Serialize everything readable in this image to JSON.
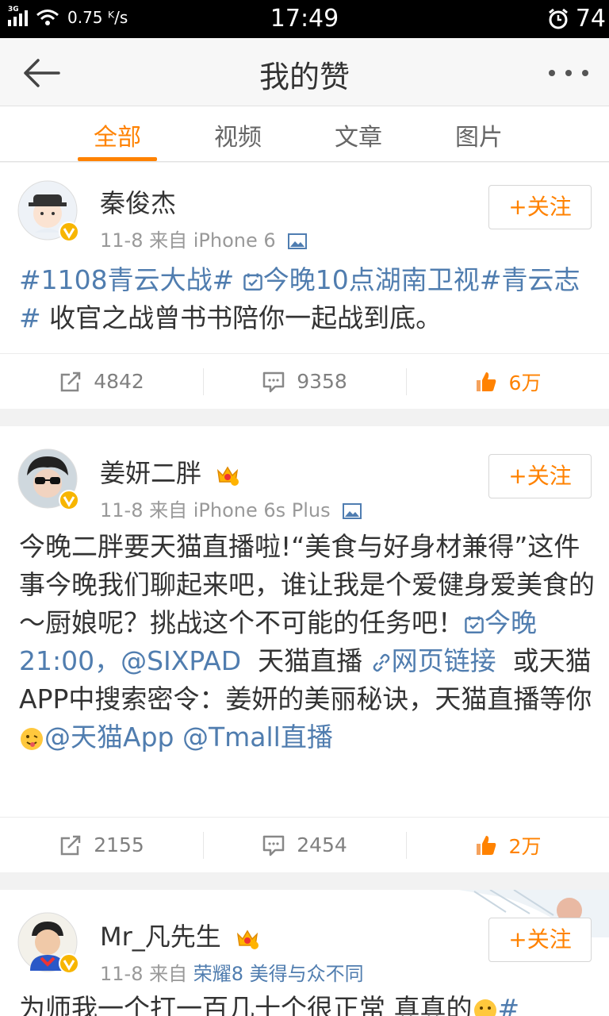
{
  "status_bar": {
    "network": "3G",
    "speed": "0.75 ᴷ/s",
    "time": "17:49",
    "battery": "74"
  },
  "nav": {
    "title": "我的赞"
  },
  "tabs": [
    {
      "label": "全部",
      "active": true
    },
    {
      "label": "视频",
      "active": false
    },
    {
      "label": "文章",
      "active": false
    },
    {
      "label": "图片",
      "active": false
    }
  ],
  "posts": [
    {
      "username": "秦俊杰",
      "date": "11-8",
      "source_prefix": "来自",
      "source": "iPhone 6",
      "follow_label": "+关注",
      "text": {
        "tag1": "#1108青云大战#",
        "tag2": "今晚10点湖南卫视",
        "tag3": "#青云志#",
        "rest": "收官之战曾书书陪你一起战到底。"
      },
      "reposts": "4842",
      "comments": "9358",
      "likes": "6万"
    },
    {
      "username": "姜妍二胖",
      "date": "11-8",
      "source_prefix": "来自",
      "source": "iPhone 6s Plus",
      "follow_label": "+关注",
      "text": {
        "p1": "今晚二胖要天猫直播啦!“美食与好身材兼得”这件事今晚我们聊起来吧，谁让我是个爱健身爱美食的～厨娘呢？挑战这个不可能的任务吧！",
        "event": "今晚21:00，",
        "mention1": "@SIXPAD",
        "p2": "天猫直播",
        "weblink": "网页链接",
        "p3": "或天猫APP中搜索密令：姜妍的美丽秘诀，天猫直播等你",
        "mention2": "@天猫App",
        "mention3": "@Tmall直播"
      },
      "reposts": "2155",
      "comments": "2454",
      "likes": "2万"
    },
    {
      "username": "Mr_凡先生",
      "date": "11-8",
      "source_prefix": "来自",
      "source": "荣耀8 美得与众不同",
      "follow_label": "+关注",
      "text": {
        "p1": "为师我一个打一百几十个很正常 真真的",
        "tail": "#"
      }
    }
  ],
  "colors": {
    "accent": "#ff8200",
    "link": "#507daf",
    "verified": "#f7b500"
  },
  "icons": [
    "back-arrow-icon",
    "more-icon",
    "repost-icon",
    "comment-icon",
    "like-icon",
    "image-icon",
    "calendar-icon",
    "link-icon",
    "crown-icon",
    "verified-icon"
  ]
}
